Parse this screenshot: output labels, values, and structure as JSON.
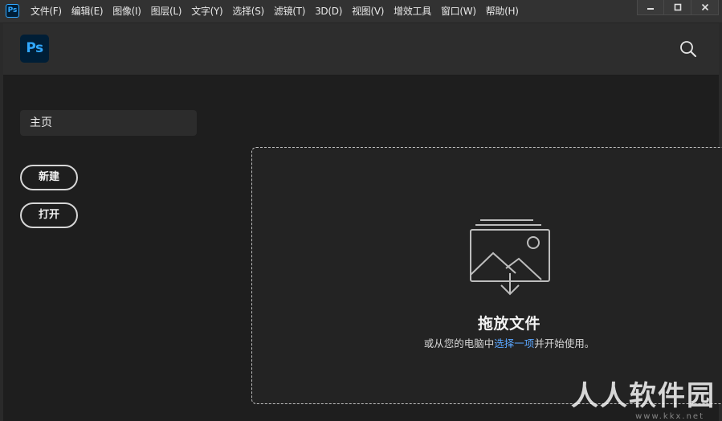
{
  "titlebar": {
    "app_icon_text": "Ps",
    "menu": [
      "文件(F)",
      "编辑(E)",
      "图像(I)",
      "图层(L)",
      "文字(Y)",
      "选择(S)",
      "滤镜(T)",
      "3D(D)",
      "视图(V)",
      "增效工具",
      "窗口(W)",
      "帮助(H)"
    ]
  },
  "header": {
    "logo_text": "Ps"
  },
  "sidebar": {
    "home_label": "主页",
    "new_label": "新建",
    "open_label": "打开"
  },
  "dropzone": {
    "title": "拖放文件",
    "subtitle_pre": "或从您的电脑中",
    "subtitle_link": "选择一项",
    "subtitle_post": "并开始使用。"
  },
  "watermark": {
    "text": "人人软件园",
    "sub": "www.kkx.net"
  },
  "colors": {
    "brand": "#31a8ff",
    "brand_bg": "#001e36",
    "link": "#5aa6ff"
  }
}
